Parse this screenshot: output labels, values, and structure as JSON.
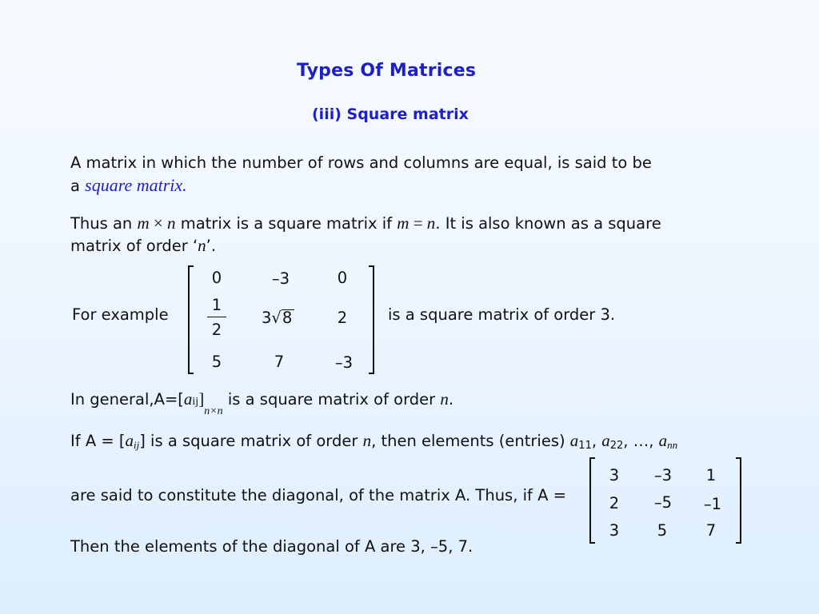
{
  "slide": {
    "title": "Types Of Matrices",
    "subtitle": "(iii) Square matrix",
    "para1": {
      "line1": "A matrix in which the number of rows and columns are equal, is said to be",
      "line2_prefix": "a ",
      "term": "square matrix."
    },
    "para2": {
      "l1_a": "Thus an ",
      "m": "m",
      "times": " × ",
      "n": "n",
      "l1_b": " matrix is a square matrix if ",
      "m2": "m",
      "eq": " = ",
      "n2": "n",
      "l1_c": ". It is also known as a square",
      "l2_a": "matrix of order ‘",
      "n3": "n",
      "l2_b": "’."
    },
    "example": {
      "label": "For example",
      "suffix": "is a square matrix of order 3.",
      "matrix": {
        "r0": [
          "0",
          "–3",
          "0"
        ],
        "r1_frac_num": "1",
        "r1_frac_den": "2",
        "r1_sqrt_coef": "3",
        "r1_sqrt_sign": "√",
        "r1_sqrt_rad": "8",
        "r1_c2": "2",
        "r2": [
          "5",
          "7",
          "–3"
        ]
      }
    },
    "general": {
      "prefix": "In general,A=[",
      "a": "a",
      "ij": "ij",
      "close": "]",
      "sub": "n×n",
      "suffix": " is a square matrix of order ",
      "n": "n",
      "end": "."
    },
    "diag": {
      "l1_a": "If A = [",
      "a": "a",
      "ij": "ij",
      "l1_b": "] is a square matrix of order ",
      "n": "n",
      "l1_c": ", then elements (entries) ",
      "a11": "a",
      "s11": "11",
      "sep1": ", ",
      "a22": "a",
      "s22": "22",
      "sep2": ", …, ",
      "ann": "a",
      "snn": "nn",
      "l2": "are said to constitute the diagonal, of the matrix A. Thus, if  A =",
      "l3": "Then the elements of the diagonal of A are 3, –5, 7.",
      "matrix": {
        "r0": [
          "3",
          "–3",
          "1"
        ],
        "r1": [
          "2",
          "–5",
          "–1"
        ],
        "r2": [
          "3",
          "5",
          "7"
        ]
      }
    }
  }
}
